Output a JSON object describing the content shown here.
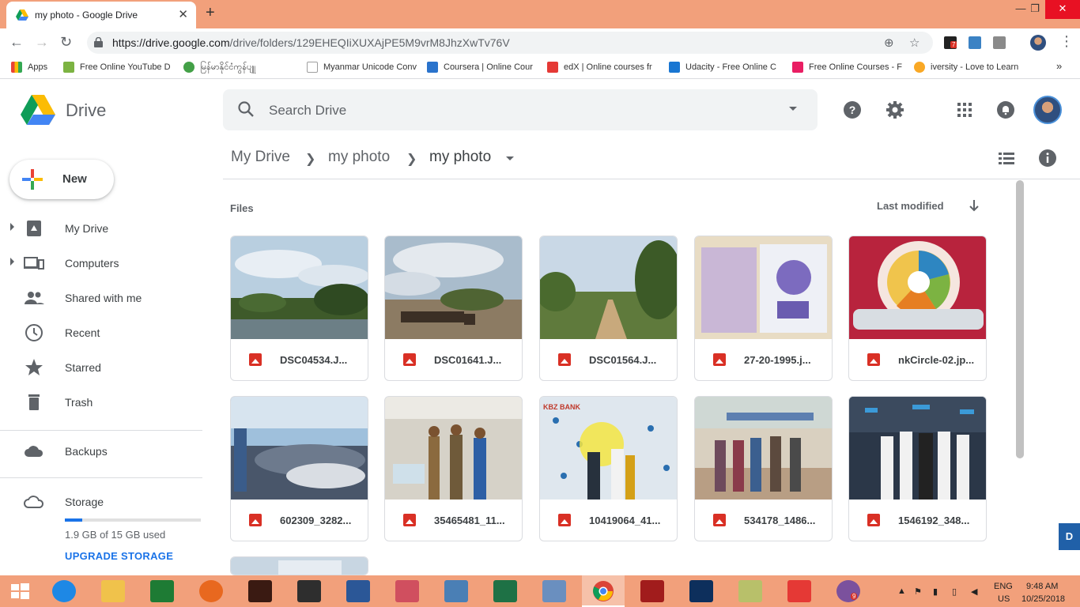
{
  "browser": {
    "tab_title": "my photo - Google Drive",
    "url_host": "https://drive.google.com",
    "url_path": "/drive/folders/129EHEQIiXUXAjPE5M9vrM8JhzXwTv76V",
    "bookmarks": [
      {
        "label": "Apps",
        "color": "#4285f4"
      },
      {
        "label": "Free Online YouTube D",
        "color": "#7cb342"
      },
      {
        "label": "မြန်မာနိုင်ငံကွန်ပျူ",
        "color": "#43a047"
      },
      {
        "label": "Myanmar Unicode Conv",
        "color": "#9e9e9e"
      },
      {
        "label": "Coursera | Online Cour",
        "color": "#2a73cc"
      },
      {
        "label": "edX | Online courses fr",
        "color": "#e53935"
      },
      {
        "label": "Udacity - Free Online C",
        "color": "#1976d2"
      },
      {
        "label": "Free Online Courses - F",
        "color": "#e91e63"
      },
      {
        "label": "iversity - Love to Learn",
        "color": "#f9a825"
      }
    ],
    "extension_badge": "7"
  },
  "drive": {
    "title": "Drive",
    "search_placeholder": "Search Drive",
    "new_label": "New",
    "nav": [
      {
        "label": "My Drive",
        "icon": "my-drive-icon"
      },
      {
        "label": "Computers",
        "icon": "computers-icon"
      },
      {
        "label": "Shared with me",
        "icon": "shared-icon"
      },
      {
        "label": "Recent",
        "icon": "clock-icon"
      },
      {
        "label": "Starred",
        "icon": "star-icon"
      },
      {
        "label": "Trash",
        "icon": "trash-icon"
      },
      {
        "label": "Backups",
        "icon": "cloud-icon"
      },
      {
        "label": "Storage",
        "icon": "cloud-outline-icon"
      }
    ],
    "storage_used_text": "1.9 GB of 15 GB used",
    "storage_fraction": 0.127,
    "upgrade_label": "UPGRADE STORAGE",
    "breadcrumb": [
      "My Drive",
      "my photo",
      "my photo"
    ],
    "files_label": "Files",
    "sort_label": "Last modified",
    "files": [
      {
        "name": "DSC04534.J..."
      },
      {
        "name": "DSC01641.J..."
      },
      {
        "name": "DSC01564.J..."
      },
      {
        "name": "27-20-1995.j..."
      },
      {
        "name": "nkCircle-02.jp..."
      },
      {
        "name": "602309_3282..."
      },
      {
        "name": "35465481_11..."
      },
      {
        "name": "10419064_41..."
      },
      {
        "name": "534178_1486..."
      },
      {
        "name": "1546192_348..."
      }
    ]
  },
  "taskbar": {
    "lang_top": "ENG",
    "lang_bottom": "US",
    "time": "9:48 AM",
    "date": "10/25/2018",
    "viber_badge": "9"
  }
}
